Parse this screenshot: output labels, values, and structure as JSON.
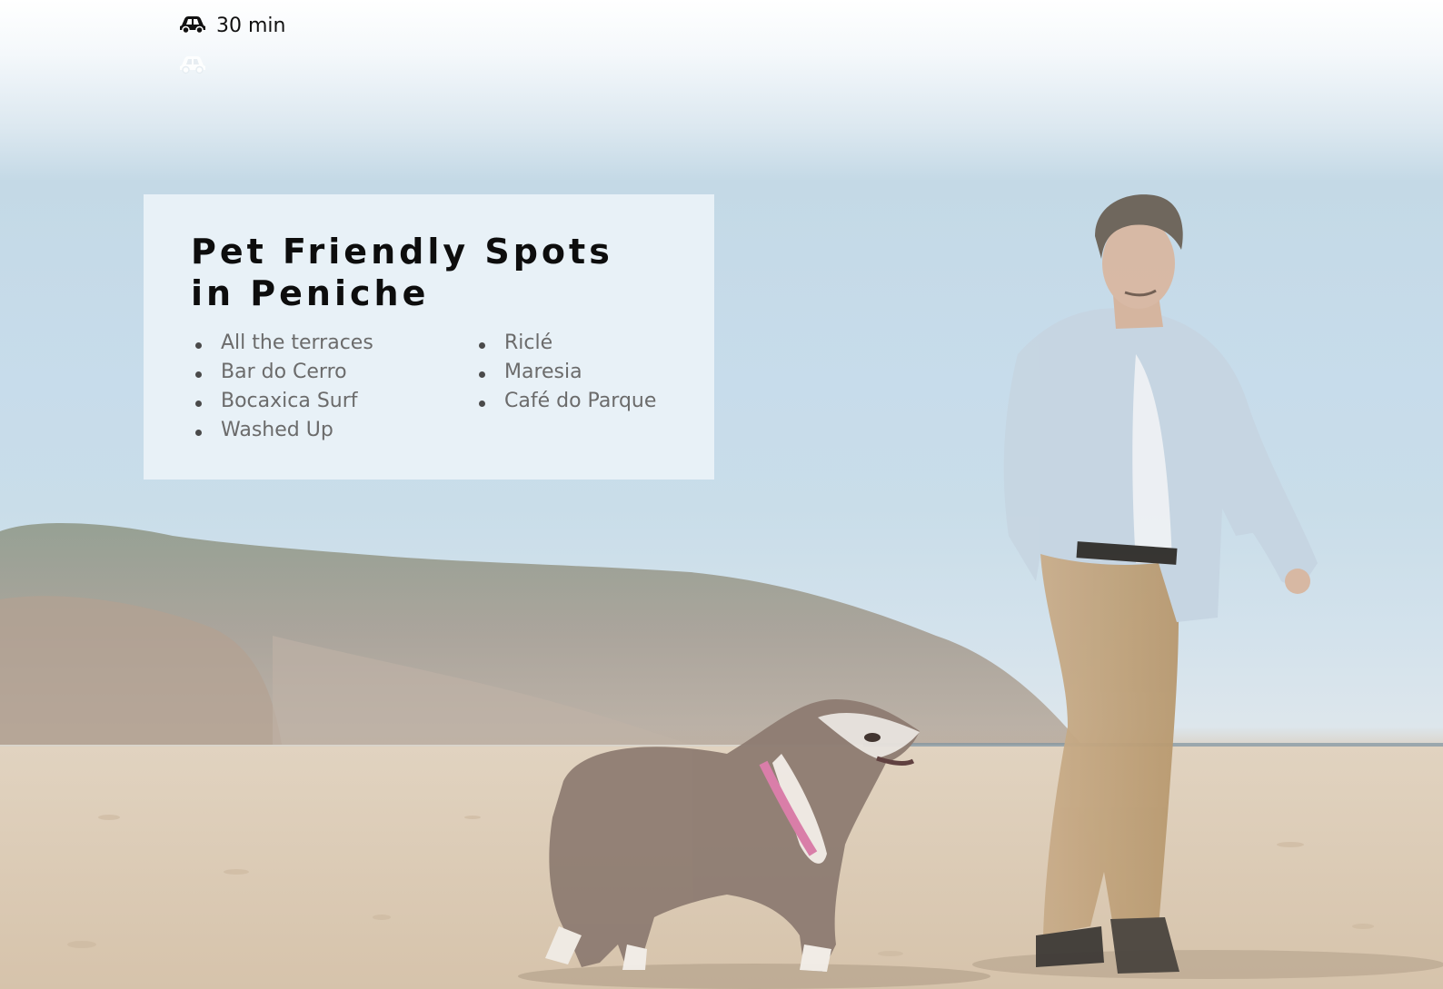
{
  "travel": {
    "car_icon": "car-icon",
    "car_time": "30 min",
    "secondary_icon": "car-icon"
  },
  "card": {
    "title": "Pet Friendly Spots in Peniche",
    "spots_left": [
      "All the terraces",
      "Bar do Cerro",
      "Bocaxica Surf",
      "Washed Up"
    ],
    "spots_right": [
      "Riclé",
      "Maresia",
      "Café do Parque"
    ]
  },
  "colors": {
    "title": "#0d0d0d",
    "list_text": "#6b6b6b",
    "card_bg": "#ebf2f8"
  }
}
